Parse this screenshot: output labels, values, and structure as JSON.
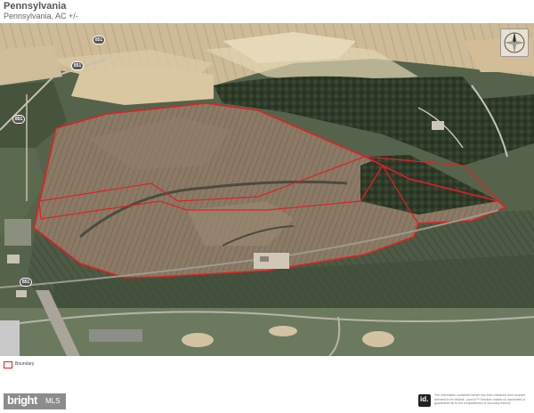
{
  "header": {
    "title": "Pennsylvania",
    "subtitle": "Pennsylvania,  AC +/-"
  },
  "map": {
    "road_labels": [
      "851",
      "851",
      "851",
      "851"
    ],
    "boundary_color": "#e02020"
  },
  "legend": {
    "boundary_label": "Boundary"
  },
  "footer": {
    "brand": "bright",
    "brand_suffix": "MLS",
    "id_logo": "id.",
    "disclaimer": "The information contained herein has been obtained from sources deemed to be reliable. Land id™ Services makes no warranties or guarantees as to the completeness or accuracy thereof."
  },
  "icons": {
    "compass": "compass-rose-icon"
  }
}
